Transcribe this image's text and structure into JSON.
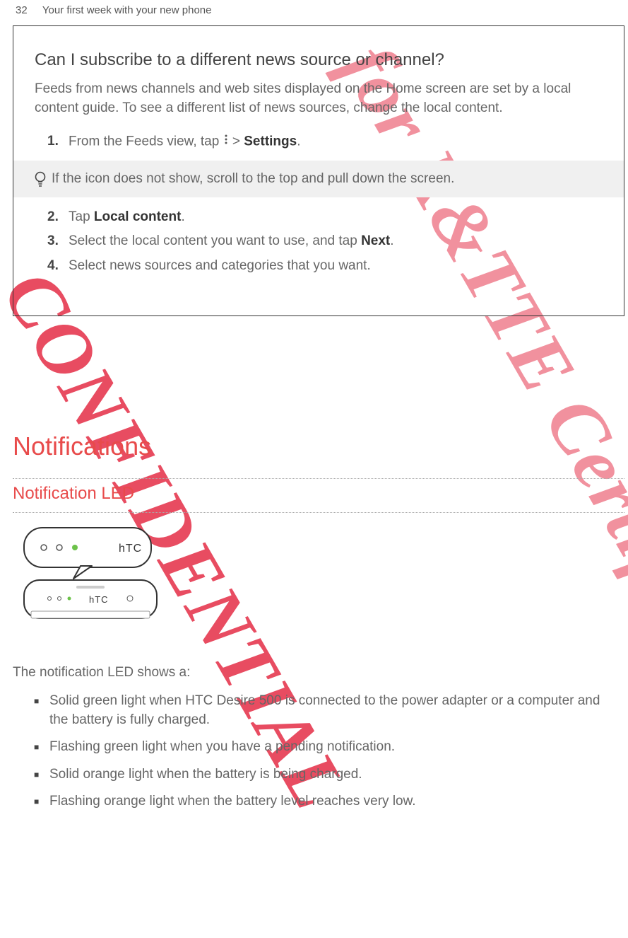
{
  "page": {
    "number": "32",
    "section": "Your first week with your new phone"
  },
  "box": {
    "question": "Can I subscribe to a different news source or channel?",
    "intro": "Feeds from news channels and web sites displayed on the Home screen are set by a local content guide. To see a different list of news sources, change the local content.",
    "step1_a": "From the Feeds view, tap ",
    "step1_b": " > ",
    "step1_bold": "Settings",
    "step1_c": ".",
    "tip": "If the icon does not show, scroll to the top and pull down the screen.",
    "step2_a": "Tap ",
    "step2_bold": "Local content",
    "step2_b": ".",
    "step3_a": "Select the local content you want to use, and tap ",
    "step3_bold": "Next",
    "step3_b": ".",
    "step4": "Select news sources and categories that you want.",
    "nums": {
      "n1": "1.",
      "n2": "2.",
      "n3": "3.",
      "n4": "4."
    }
  },
  "h1": "Notifications",
  "h2": "Notification LED",
  "ledpara": "The notification LED shows a:",
  "bullets": {
    "b1": "Solid green light when HTC Desire 500 is connected to the power adapter or a computer and the battery is fully charged.",
    "b2": "Flashing green light when you have a pending notification.",
    "b3": "Solid orange light when the battery is being charged.",
    "b4": "Flashing orange light when the battery level reaches very low."
  },
  "watermarks": {
    "w1": "CONFIDENTIAL",
    "w2": "for R&TTE Certification only"
  }
}
